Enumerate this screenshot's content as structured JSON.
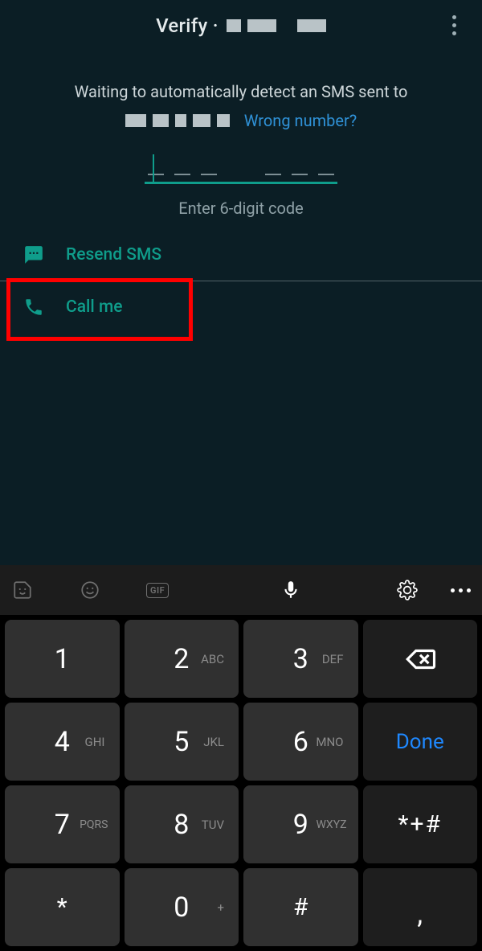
{
  "header": {
    "title_prefix": "Verify ·"
  },
  "waiting": {
    "line1": "Waiting to automatically detect an SMS sent to",
    "wrong": "Wrong number?"
  },
  "code": {
    "hint": "Enter 6-digit code",
    "value": ""
  },
  "actions": {
    "resend": "Resend SMS",
    "callme": "Call me"
  },
  "keyboard": {
    "gif_label": "GIF",
    "keys": [
      {
        "n": "1",
        "s": ""
      },
      {
        "n": "2",
        "s": "ABC"
      },
      {
        "n": "3",
        "s": "DEF"
      },
      {
        "n": "backspace",
        "s": ""
      },
      {
        "n": "4",
        "s": "GHI"
      },
      {
        "n": "5",
        "s": "JKL"
      },
      {
        "n": "6",
        "s": "MNO"
      },
      {
        "n": "Done",
        "s": ""
      },
      {
        "n": "7",
        "s": "PQRS"
      },
      {
        "n": "8",
        "s": "TUV"
      },
      {
        "n": "9",
        "s": "WXYZ"
      },
      {
        "n": "*+#",
        "s": ""
      },
      {
        "n": "*",
        "s": ""
      },
      {
        "n": "0",
        "s": "+"
      },
      {
        "n": "#",
        "s": ""
      },
      {
        "n": ",",
        "s": ""
      }
    ]
  },
  "colors": {
    "accent": "#0f9d8b",
    "link": "#2f91d6",
    "done": "#1e88ff",
    "highlight_box": "#ff0000"
  }
}
